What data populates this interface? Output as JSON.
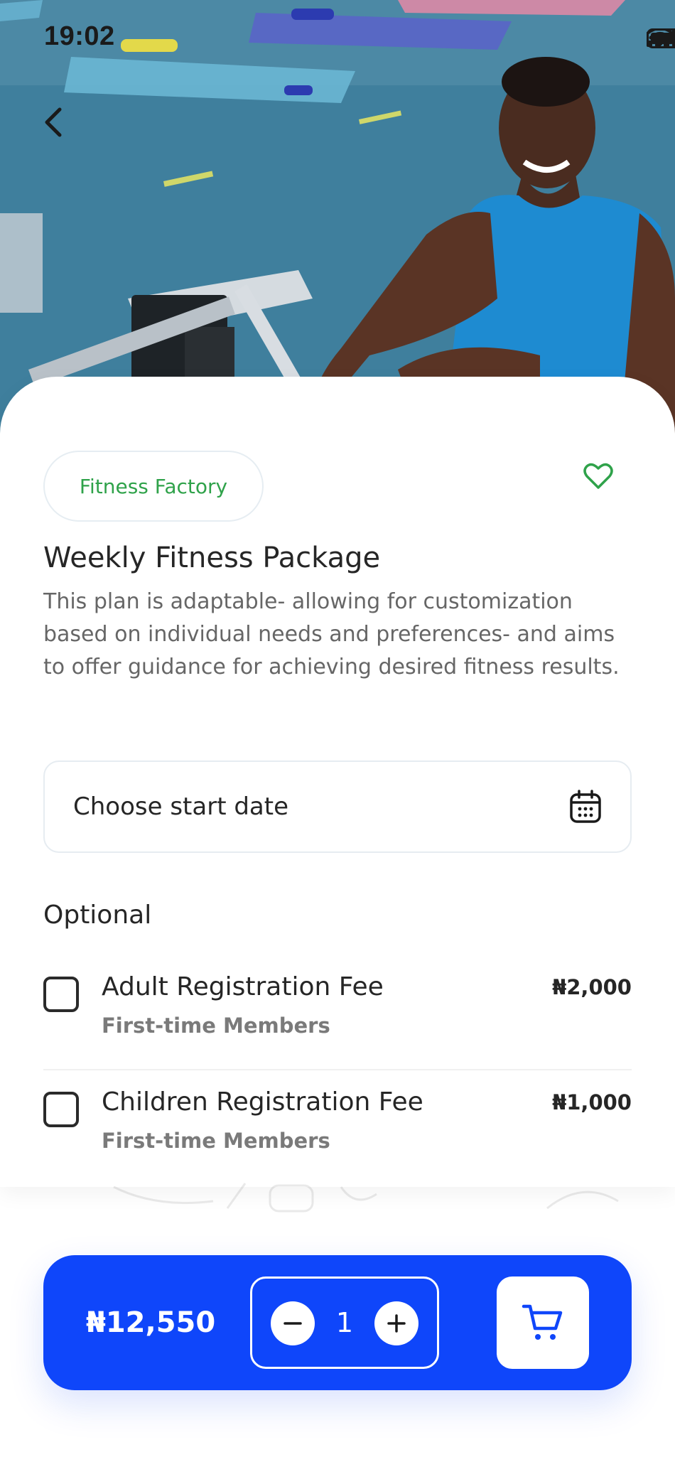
{
  "status_bar": {
    "time": "19:02",
    "signal_icon": "cellular-signal-icon",
    "wifi_icon": "wifi-icon",
    "battery_icon": "battery-icon"
  },
  "hero": {
    "image": "gym-trainer-photo",
    "back_icon": "chevron-left-icon"
  },
  "details": {
    "provider": "Fitness Factory",
    "favorite_icon": "heart-outline-icon",
    "title": "Weekly Fitness Package",
    "description": "This plan is adaptable- allowing for customization based on individual needs and preferences- and aims to offer guidance for achieving desired fitness results.",
    "start_date_placeholder": "Choose start date",
    "calendar_icon": "calendar-icon"
  },
  "optional": {
    "label": "Optional",
    "items": [
      {
        "name": "Adult Registration Fee",
        "subtitle": "First-time Members",
        "price": "₦2,000",
        "checked": false
      },
      {
        "name": "Children Registration Fee",
        "subtitle": "First-time Members",
        "price": "₦1,000",
        "checked": false
      }
    ]
  },
  "cart": {
    "total": "₦12,550",
    "quantity": "1",
    "minus_icon": "minus-icon",
    "plus_icon": "plus-icon",
    "cart_icon": "shopping-cart-icon"
  },
  "colors": {
    "accent": "#0f46fa",
    "provider_green": "#2fa24a"
  }
}
